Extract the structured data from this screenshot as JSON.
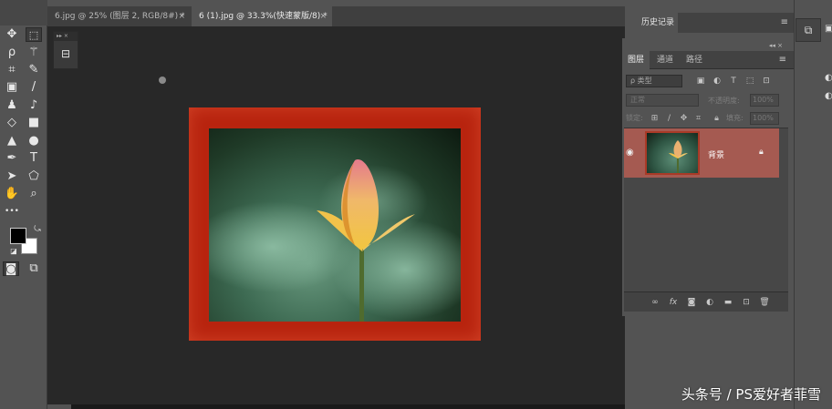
{
  "tabs": [
    {
      "label": "6.jpg @ 25% (图层 2, RGB/8#) *",
      "close": "×",
      "active": false
    },
    {
      "label": "6 (1).jpg @ 33.3%(快速蒙版/8) *",
      "close": "×",
      "active": true
    }
  ],
  "toolbar": {
    "more": "•••",
    "icons": [
      "move-icon",
      "marquee-icon",
      "lasso-icon",
      "magic-wand-icon",
      "crop-icon",
      "eyedropper-icon",
      "frame-icon",
      "brush-icon",
      "stamp-icon",
      "history-brush-icon",
      "eraser-icon",
      "gradient-icon",
      "blur-icon",
      "dodge-icon",
      "pen-icon",
      "type-icon",
      "path-select-icon",
      "shape-icon",
      "hand-icon",
      "zoom-icon",
      "quick-mask-icon",
      "screen-mode-icon"
    ],
    "foreground_color": "#000000",
    "background_color": "#ffffff"
  },
  "history_panel": {
    "tab": "历史记录",
    "menu": "≡"
  },
  "layers_panel": {
    "tabs": [
      "图层",
      "通道",
      "路径"
    ],
    "menu": "≡",
    "filter_kind": "ρ 类型",
    "blend_mode": "正常",
    "opacity_label": "不透明度:",
    "opacity_value": "100%",
    "lock_label": "锁定:",
    "fill_label": "填充:",
    "fill_value": "100%",
    "layers": [
      {
        "name": "背景",
        "visible": true,
        "locked": true
      }
    ]
  },
  "canvas": {
    "frame_color": "#b8240f"
  },
  "watermark": "头条号 / PS爱好者菲雪"
}
